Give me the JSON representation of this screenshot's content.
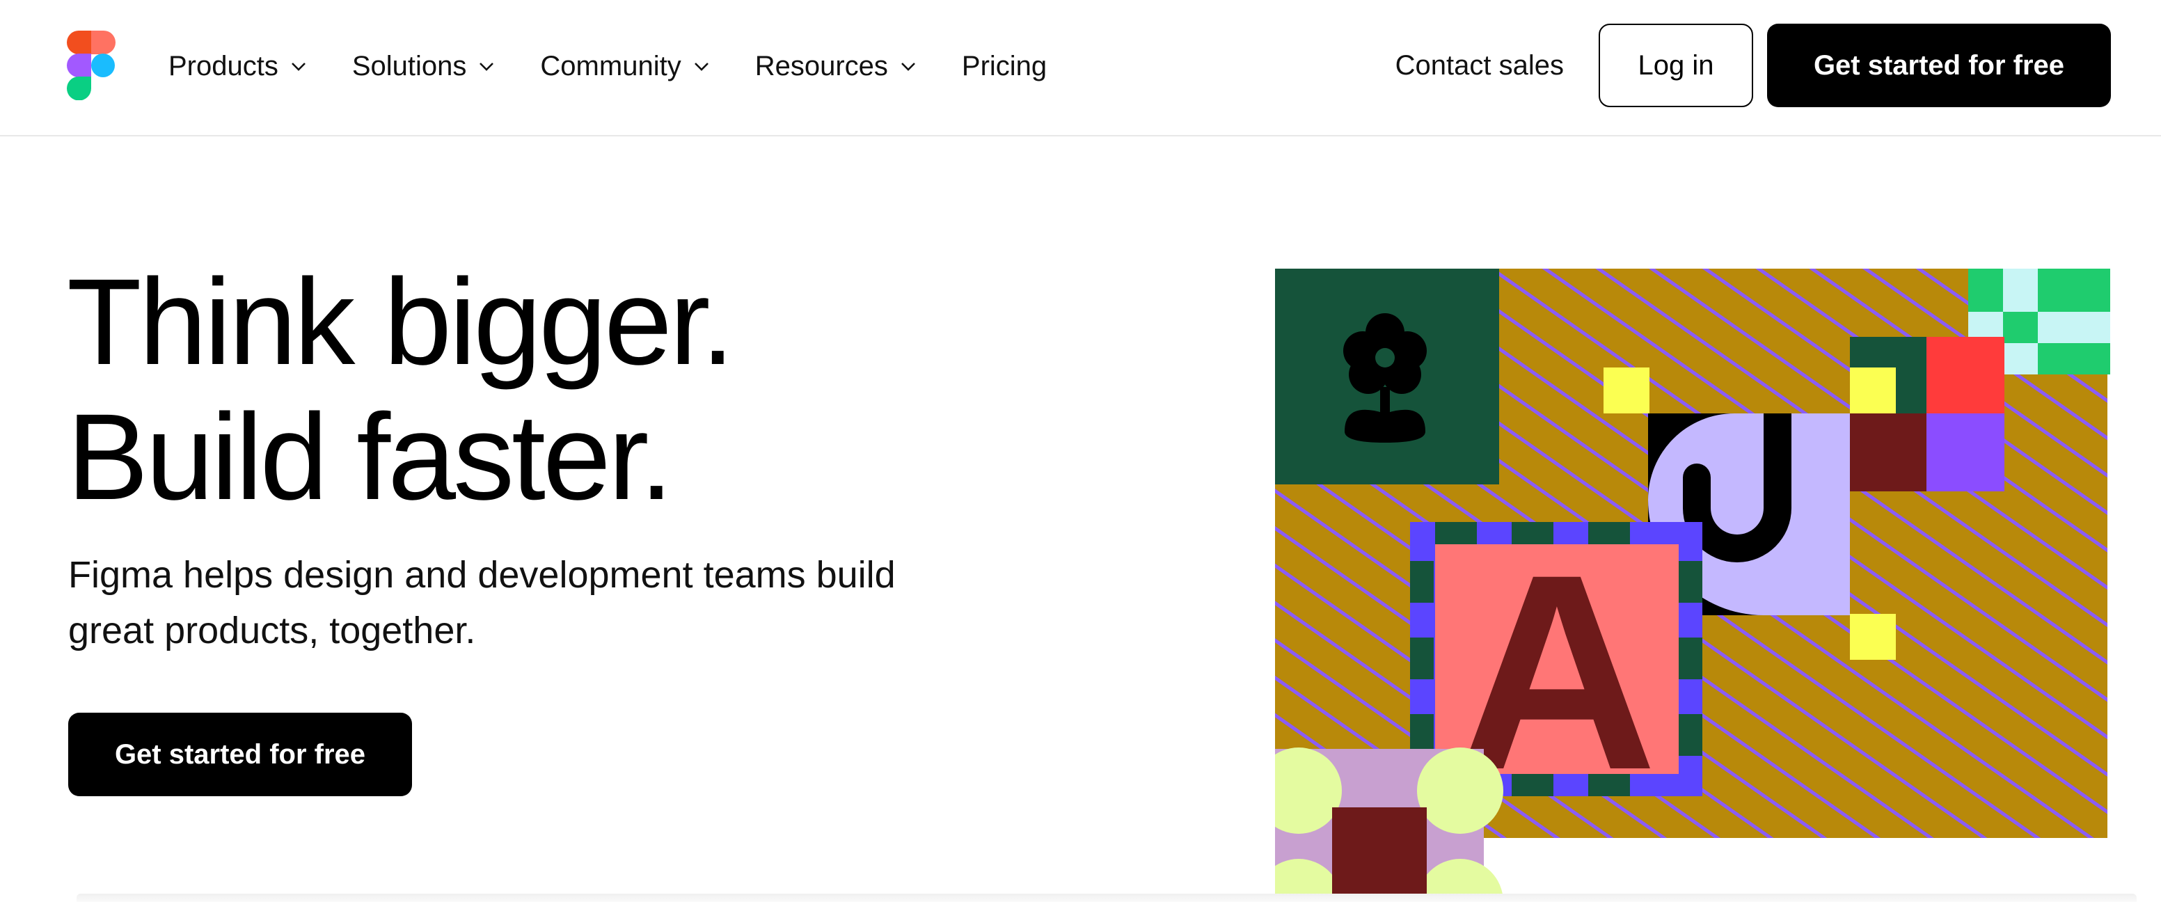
{
  "nav": {
    "logo_name": "figma-logo",
    "items": [
      {
        "label": "Products",
        "has_dropdown": true
      },
      {
        "label": "Solutions",
        "has_dropdown": true
      },
      {
        "label": "Community",
        "has_dropdown": true
      },
      {
        "label": "Resources",
        "has_dropdown": true
      },
      {
        "label": "Pricing",
        "has_dropdown": false
      }
    ],
    "contact_sales": "Contact sales",
    "login": "Log in",
    "get_started": "Get started for free"
  },
  "hero": {
    "title_line1": "Think bigger.",
    "title_line2": "Build faster.",
    "subtitle": "Figma helps design and development teams build great products, together.",
    "cta": "Get started for free"
  },
  "illustration": {
    "letter": "A",
    "colors": {
      "stripe_bg": "#b8890a",
      "stripe_line": "#8b5cf6",
      "dark_green": "#15533a",
      "coral": "#ff7676",
      "maroon": "#6e1a1a",
      "lavender": "#c4b8ff",
      "blue": "#5b45ff",
      "yellow": "#fbff52",
      "red": "#ff3b3b",
      "purple": "#8b4dff",
      "mint": "#1fcc6e",
      "light_cyan": "#c8f5f5",
      "lime": "#e4fba0",
      "mauve": "#c8a0d0"
    }
  }
}
